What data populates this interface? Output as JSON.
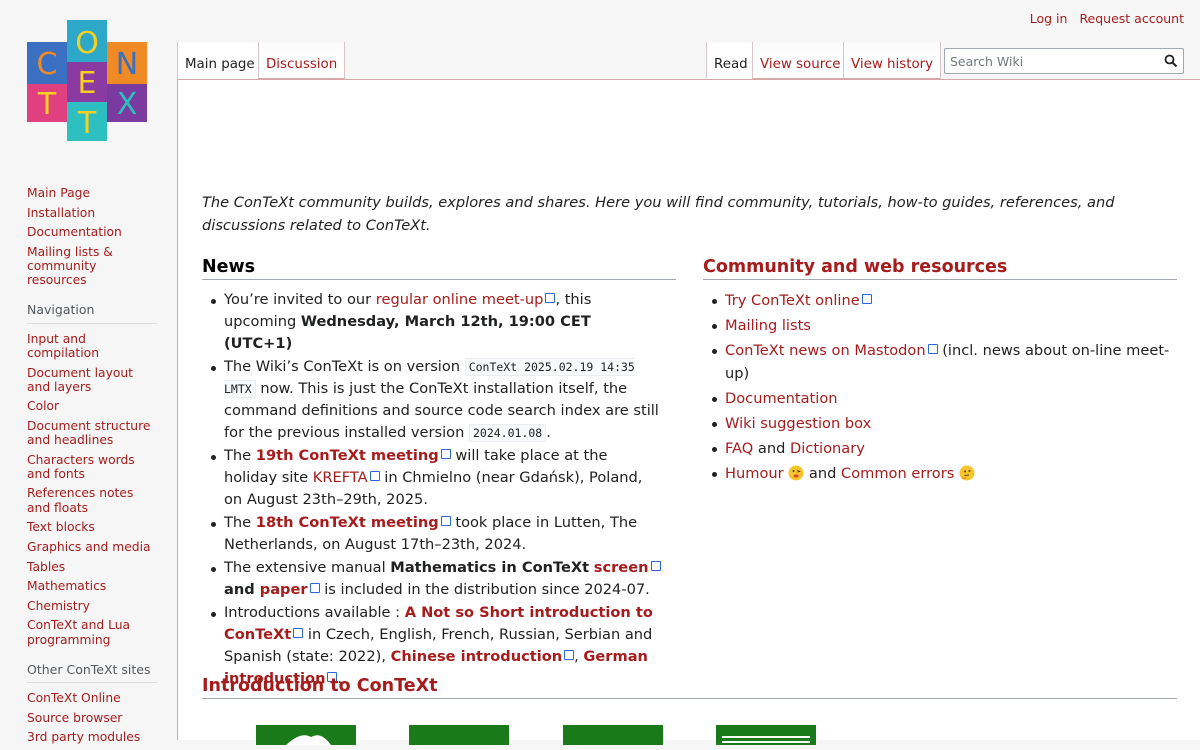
{
  "personal": {
    "login": "Log in",
    "request": "Request account"
  },
  "logo": {
    "letters": [
      "C",
      "O",
      "N",
      "T",
      "E",
      "X",
      "T"
    ]
  },
  "tabs": {
    "main_page": "Main page",
    "discussion": "Discussion",
    "read": "Read",
    "view_source": "View source",
    "view_history": "View history"
  },
  "search": {
    "placeholder": "Search Wiki"
  },
  "sidebar": {
    "main": [
      "Main Page",
      "Installation",
      "Documentation",
      "Mailing lists & community resources"
    ],
    "navigation_title": "Navigation",
    "navigation": [
      "Input and compilation",
      "Document layout and layers",
      "Color",
      "Document structure and headlines",
      "Characters words and fonts",
      "References notes and floats",
      "Text blocks",
      "Graphics and media",
      "Tables",
      "Mathematics",
      "Chemistry",
      "ConTeXt and Lua programming"
    ],
    "other_title": "Other ConTeXt sites",
    "other": [
      "ConTeXt Online",
      "Source browser",
      "3rd party modules"
    ]
  },
  "intro": "The ConTeXt community builds, explores and shares. Here you will find community, tutorials, how-to guides, references, and discussions related to ConTeXt.",
  "news": {
    "title": "News",
    "n1": {
      "a": "You’re invited to our ",
      "link": "regular online meet-up",
      "b": ", this upcoming ",
      "bold": "Wednesday, March 12th, 19:00 CET (UTC+1)"
    },
    "n2": {
      "a": "The Wiki’s ConTeXt is on version ",
      "code1": "ConTeXt 2025.02.19 14:35 LMTX",
      "b": " now. This is just the ConTeXt installation itself, the command definitions and source code search index are still for the previous installed version ",
      "code2": "2024.01.08",
      "c": "."
    },
    "n3": {
      "a": "The ",
      "link": "19th ConTeXt meeting",
      "b": " will take place at the holiday site ",
      "link2": "KREFTA",
      "c": " in Chmielno (near Gdańsk), Poland, on August 23th–29th, 2025."
    },
    "n4": {
      "a": "The ",
      "link": "18th ConTeXt meeting",
      "b": " took place in Lutten, The Netherlands, on August 17th–23th, 2024."
    },
    "n5": {
      "a": "The extensive manual ",
      "bold": "Mathematics in ConTeXt",
      "link": "screen",
      "and": " and ",
      "link2": "paper",
      "b": " is included in the distribution since 2024-07."
    },
    "n6": {
      "a": "Introductions available : ",
      "link": "A Not so Short introduction to ConTeXt",
      "b": " in Czech, English, French, Russian, Serbian and Spanish (state: 2022), ",
      "link2": "Chinese introduction",
      "c": ", ",
      "link3": "German introduction",
      "d": "."
    }
  },
  "community": {
    "title": "Community and web resources",
    "c1": "Try ConTeXt online",
    "c2": "Mailing lists",
    "c3": "ConTeXt news on Mastodon",
    "c3b": " (incl. news about on-line meet-up)",
    "c4": "Documentation",
    "c5": "Wiki suggestion box",
    "c6a": "FAQ",
    "c6and": " and ",
    "c6b": "Dictionary",
    "c7a": "Humour",
    "c7and": " and ",
    "c7b": "Common errors"
  },
  "intro_section": {
    "title": "Introduction to ConTeXt"
  },
  "colors": {
    "link": "#a61c1c",
    "text": "#202122",
    "accent_border": "#d7a6a6",
    "thumb": "#1a7a1a"
  }
}
